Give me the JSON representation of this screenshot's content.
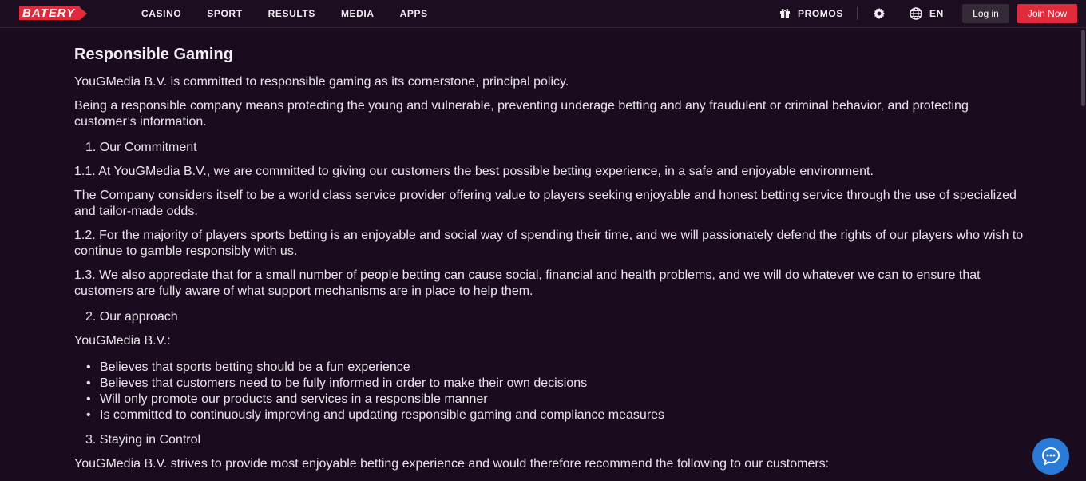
{
  "brand": {
    "logo_text": "BATERY"
  },
  "nav": [
    "CASINO",
    "SPORT",
    "RESULTS",
    "MEDIA",
    "APPS"
  ],
  "header_right": {
    "promos": "PROMOS",
    "language": "EN",
    "login": "Log in",
    "join": "Join Now"
  },
  "article": {
    "title": "Responsible Gaming",
    "intro": "YouGMedia B.V. is committed to responsible gaming as its cornerstone, principal policy.",
    "intro2": "Being a responsible company means protecting the young and vulnerable, preventing underage betting and any fraudulent or criminal behavior, and protecting customer’s information.",
    "section1": "1. Our Commitment",
    "p1_1": "1.1. At YouGMedia B.V., we are committed to giving our customers the best possible betting experience, in a safe and enjoyable environment.",
    "p1_1b": "The Company considers itself to be a world class service provider offering value to players seeking enjoyable and honest betting service through the use of specialized and tailor-made odds.",
    "p1_2": "1.2. For the majority of players sports betting is an enjoyable and social way of spending their time, and we will passionately defend the rights of our players who wish to continue to gamble responsibly with us.",
    "p1_3": "1.3. We also appreciate that for a small number of people betting can cause social, financial and health problems, and we will do whatever we can to ensure that customers are fully aware of what support mechanisms are in place to help them.",
    "section2": "2. Our approach",
    "approach_lead": "YouGMedia B.V.:",
    "approach_items": [
      "Believes that sports betting should be a fun experience",
      "Believes that customers need to be fully informed in order to make their own decisions",
      "Will only promote our products and services in a responsible manner",
      "Is committed to continuously improving and updating responsible gaming and compliance measures"
    ],
    "section3": "3. Staying in Control",
    "p3": "YouGMedia B.V. strives to provide most enjoyable betting experience and would therefore recommend the following to our customers:"
  }
}
